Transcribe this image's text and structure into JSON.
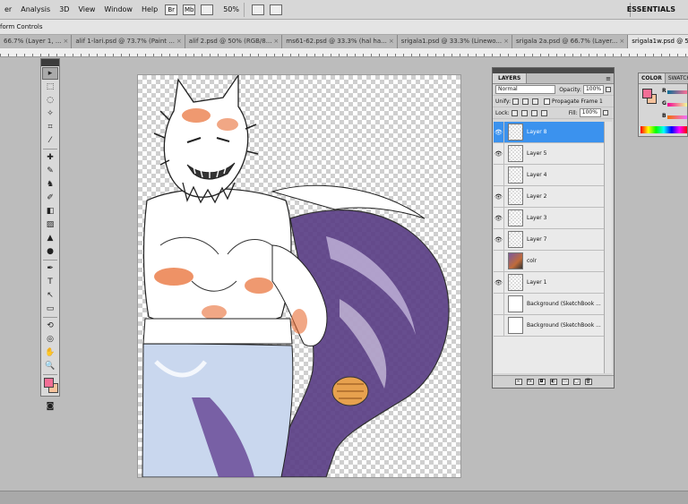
{
  "menubar": {
    "items": [
      "er",
      "Analysis",
      "3D",
      "View",
      "Window",
      "Help"
    ],
    "icons": [
      "Br",
      "Mb"
    ],
    "zoom": "50%",
    "workspace": "ESSENTIALS"
  },
  "options": {
    "label": "form Controls"
  },
  "tabs": [
    "66.7% (Layer 1, ...",
    "alif 1-lari.psd @ 73.7% (Paint ...",
    "alif 2.psd @ 50% (RGB/8...",
    "ms61-62.psd @ 33.3% (hal ha...",
    "srigala1.psd @ 33.3% (Linewo...",
    "srigala 2a.psd @ 66.7% (Layer...",
    "srigala1w.psd @ 50% (Layer 8,..."
  ],
  "active_tab_index": 6,
  "toolbox": {
    "tools": [
      "move-tool",
      "marquee-tool",
      "lasso-tool",
      "quick-select-tool",
      "crop-tool",
      "eyedropper-tool",
      "healing-brush-tool",
      "brush-tool",
      "clone-stamp-tool",
      "history-brush-tool",
      "eraser-tool",
      "gradient-tool",
      "blur-tool",
      "dodge-tool",
      "pen-tool",
      "type-tool",
      "path-select-tool",
      "shape-tool",
      "3d-rotate-tool",
      "3d-orbit-tool",
      "hand-tool",
      "zoom-tool"
    ],
    "glyphs": [
      "▸",
      "⬚",
      "◌",
      "✧",
      "⌗",
      "⁄",
      "✚",
      "✎",
      "♞",
      "✐",
      "◧",
      "▨",
      "▲",
      "●",
      "✒",
      "T",
      "↖",
      "▭",
      "⟲",
      "◎",
      "✋",
      "🔍"
    ],
    "foreground_color": "#f36e96",
    "background_color": "#f7c39d"
  },
  "layers_panel": {
    "tab": "LAYERS",
    "blend_mode": "Normal",
    "opacity_label": "Opacity:",
    "opacity_value": "100%",
    "unify_label": "Unify:",
    "propagate_label": "Propagate Frame 1",
    "lock_label": "Lock:",
    "fill_label": "Fill:",
    "fill_value": "100%",
    "layers": [
      {
        "name": "Layer 8",
        "visible": true,
        "selected": true,
        "thumb": "checker"
      },
      {
        "name": "Layer 5",
        "visible": true,
        "selected": false,
        "thumb": "checker"
      },
      {
        "name": "Layer 4",
        "visible": false,
        "selected": false,
        "thumb": "checker"
      },
      {
        "name": "Layer 2",
        "visible": true,
        "selected": false,
        "thumb": "checker"
      },
      {
        "name": "Layer 3",
        "visible": true,
        "selected": false,
        "thumb": "checker"
      },
      {
        "name": "Layer 7",
        "visible": true,
        "selected": false,
        "thumb": "checker"
      },
      {
        "name": "colr",
        "visible": false,
        "selected": false,
        "thumb": "color"
      },
      {
        "name": "Layer 1",
        "visible": true,
        "selected": false,
        "thumb": "checker"
      },
      {
        "name": "Background (SketchBook ...",
        "visible": false,
        "selected": false,
        "thumb": "plain"
      },
      {
        "name": "Background (SketchBook ...",
        "visible": false,
        "selected": false,
        "thumb": "plain"
      }
    ],
    "bottom_icons": [
      "link-layers-icon",
      "fx-icon",
      "layer-mask-icon",
      "adjustment-layer-icon",
      "group-icon",
      "new-layer-icon",
      "delete-layer-icon"
    ]
  },
  "color_panel": {
    "tabs": [
      "COLOR",
      "SWATCH"
    ],
    "channels": [
      "R",
      "G",
      "B"
    ],
    "foreground": "#f36e96",
    "background": "#f7c39d"
  }
}
